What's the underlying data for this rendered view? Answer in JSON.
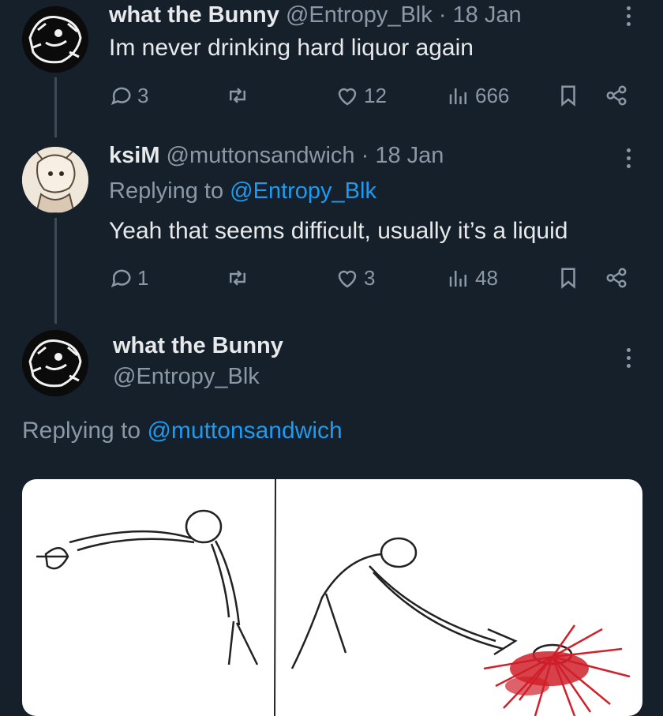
{
  "tweets": [
    {
      "name": "what the Bunny",
      "handle": "@Entropy_Blk",
      "date": "· 18 Jan",
      "text": "Im never drinking hard liquor again",
      "replies": "3",
      "likes": "12",
      "views": "666"
    },
    {
      "name": "ksiM",
      "handle": "@muttonsandwich",
      "date": "· 18 Jan",
      "replying_prefix": "Replying to",
      "replying_to": "@Entropy_Blk",
      "text": "Yeah that seems difficult, usually it’s a liquid",
      "replies": "1",
      "likes": "3",
      "views": "48"
    },
    {
      "name": "what the Bunny",
      "handle": "@Entropy_Blk",
      "replying_prefix": "Replying to",
      "replying_to": "@muttonsandwich"
    }
  ],
  "colors": {
    "background": "#15202b",
    "accent": "#1d9bf0",
    "muted": "#8b98a5"
  },
  "icons": [
    "reply-icon",
    "retweet-icon",
    "like-icon",
    "views-icon",
    "bookmark-icon",
    "share-icon",
    "more-icon"
  ]
}
